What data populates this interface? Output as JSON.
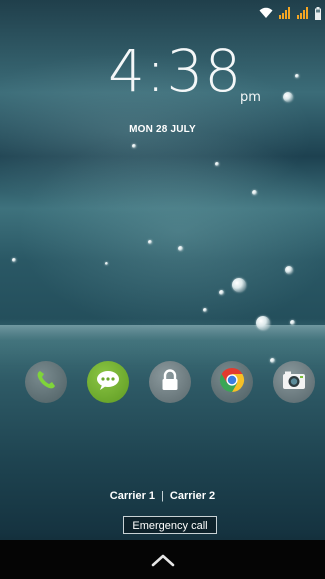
{
  "status_bar": {
    "icons": [
      "wifi-icon",
      "signal-icon",
      "signal-icon",
      "battery-icon"
    ],
    "signal_color": "#f5a623"
  },
  "lock_screen": {
    "time": "4:38",
    "ampm": "pm",
    "date": "MON 28 JULY"
  },
  "dock": {
    "apps": [
      "phone-icon",
      "messaging-icon",
      "lock-icon",
      "chrome-icon",
      "camera-icon"
    ]
  },
  "carriers": {
    "carrier_1": "Carrier 1",
    "separator": "|",
    "carrier_2": "Carrier 2"
  },
  "emergency_call_label": "Emergency call",
  "nav_bar": {
    "icon": "chevron-up-icon"
  }
}
